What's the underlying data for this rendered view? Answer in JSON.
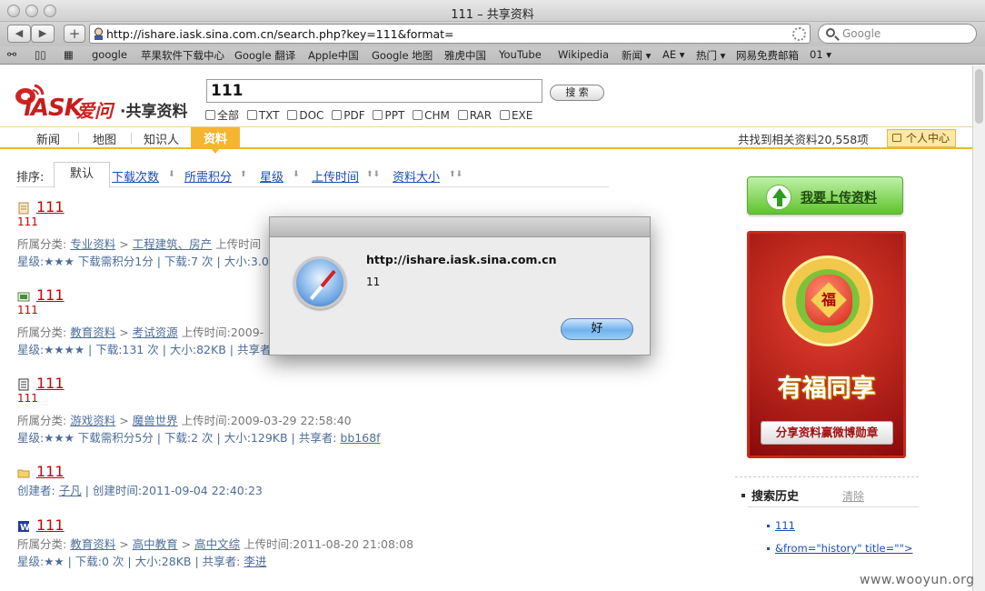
{
  "window": {
    "title": "111 – 共享资料"
  },
  "toolbar": {
    "back": "◀",
    "forward": "▶",
    "add": "+",
    "url": "http://ishare.iask.sina.com.cn/search.php?key=111&format=",
    "search_placeholder": "Google"
  },
  "bookmarks": [
    "google",
    "苹果软件下载中心",
    "Google 翻译",
    "Apple中国",
    "Google 地图",
    "雅虎中国",
    "YouTube",
    "Wikipedia",
    "新闻 ▾",
    "AE ▾",
    "热门 ▾",
    "网易免费邮箱",
    "01 ▾"
  ],
  "site": {
    "logo_iask": "iASK",
    "logo_aiwen": "爱问",
    "logo_suffix": "·共享资料",
    "query": "111",
    "search_button": "搜 索",
    "formats": [
      "全部",
      "TXT",
      "DOC",
      "PDF",
      "PPT",
      "CHM",
      "RAR",
      "EXE"
    ],
    "tabs": [
      "新闻",
      "地图",
      "知识人",
      "资料"
    ],
    "found_text": "共找到相关资料20,558项",
    "user_center": "个人中心",
    "sort_label": "排序:",
    "sort_default": "默认",
    "sort_options": [
      "下载次数",
      "所需积分",
      "星级",
      "上传时间",
      "资料大小"
    ]
  },
  "results": [
    {
      "title": "111",
      "sub": "111",
      "cat_label": "所属分类:",
      "cat1": "专业资料",
      "cat2": "工程建筑、房产",
      "after": "上传时间",
      "meta": "星级:★★★ 下载需积分1分 | 下载:7 次 | 大小:3.0"
    },
    {
      "title": "111",
      "sub": "111",
      "cat_label": "所属分类:",
      "cat1": "教育资料",
      "cat2": "考试资源",
      "after": "上传时间:2009-",
      "meta": "星级:★★★★ | 下载:131 次 | 大小:82KB | 共享者"
    },
    {
      "title": "111",
      "sub": "111",
      "cat_label": "所属分类:",
      "cat1": "游戏资料",
      "cat2": "魔兽世界",
      "after": "上传时间:2009-03-29 22:58:40",
      "meta": "星级:★★★ 下载需积分5分 | 下载:2 次 | 大小:129KB | 共享者:",
      "sharer": "bb168f"
    },
    {
      "title": "111",
      "creator_label": "创建者:",
      "creator": "子凡",
      "created": "| 创建时间:2011-09-04 22:40:23"
    },
    {
      "title": "111",
      "cat_label": "所属分类:",
      "cat1": "教育资料",
      "cat2": "高中教育",
      "cat3": "高中文综",
      "after": "上传时间:2011-08-20 21:08:08",
      "meta": "星级:★★ | 下载:0 次 | 大小:28KB | 共享者:",
      "sharer": "李进"
    }
  ],
  "sidebar": {
    "upload_label": "我要上传资料",
    "promo_slogan": "有福同享",
    "promo_bag_char": "福",
    "promo_cta": "分享资料赢微博勋章",
    "history_title": "搜索历史",
    "history_clear": "清除",
    "history_items": [
      "111",
      "&from=\"history\" title=\"\">"
    ]
  },
  "dialog": {
    "host": "http://ishare.iask.sina.com.cn",
    "message": "11",
    "ok": "好"
  },
  "watermark": "www.wooyun.org",
  "colors": {
    "accent": "#f4b531",
    "link": "#1a4fb5",
    "result_title": "#cc0000"
  }
}
